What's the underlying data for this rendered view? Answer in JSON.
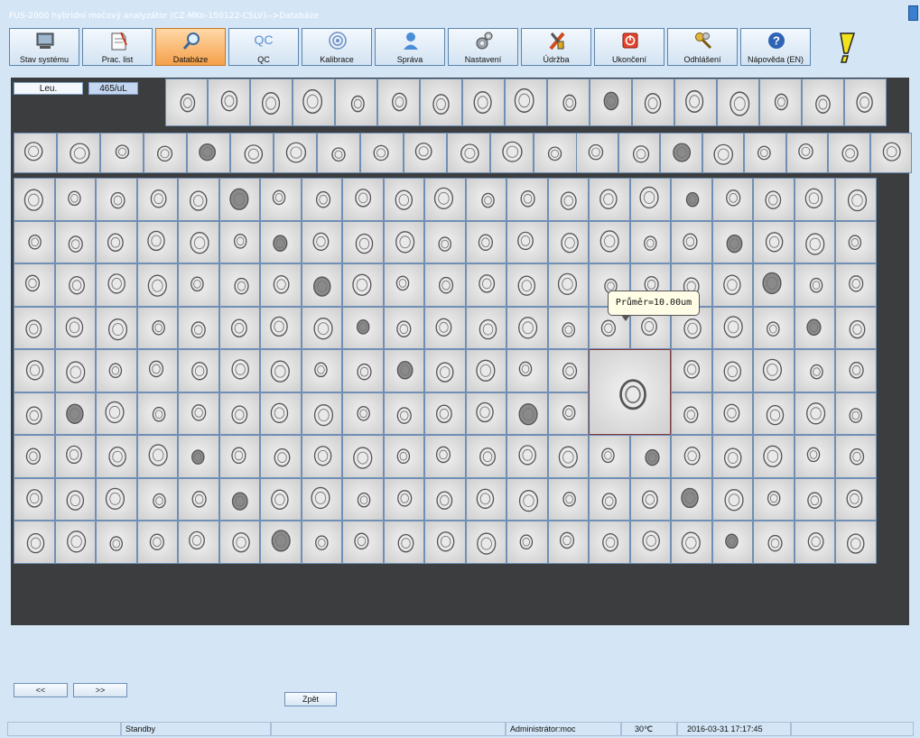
{
  "window": {
    "title": "FUS-2000 hybridní močový analyzátor (CZ-MKo-150122-CSLV)-->Databáze"
  },
  "toolbar": [
    {
      "label": "Stav systému",
      "icon": "monitor-icon"
    },
    {
      "label": "Prac. list",
      "icon": "worksheet-icon"
    },
    {
      "label": "Databáze",
      "icon": "magnifier-icon",
      "active": true
    },
    {
      "label": "QC",
      "icon": "qc-icon",
      "glyph": "QC"
    },
    {
      "label": "Kalibrace",
      "icon": "target-icon"
    },
    {
      "label": "Správa",
      "icon": "user-icon"
    },
    {
      "label": "Nastavení",
      "icon": "gears-icon"
    },
    {
      "label": "Údržba",
      "icon": "tools-icon"
    },
    {
      "label": "Ukončení",
      "icon": "power-icon"
    },
    {
      "label": "Odhlášení",
      "icon": "keys-icon"
    },
    {
      "label": "Nápověda (EN)",
      "icon": "help-icon"
    }
  ],
  "sediment": {
    "category": "Leu.",
    "count": "465/uL"
  },
  "tooltip": {
    "text": "Průměr=10.00um"
  },
  "nav": {
    "prev": "<<",
    "next": ">>",
    "back": "Zpět"
  },
  "status": {
    "state": "Standby",
    "user": "Administrátor:moc",
    "temperature": "30℃",
    "datetime": "2016-03-31 17:17:45"
  },
  "colors": {
    "accent": "#f5a04a",
    "panel": "#3b3d3f",
    "background": "#d4e6f6"
  }
}
